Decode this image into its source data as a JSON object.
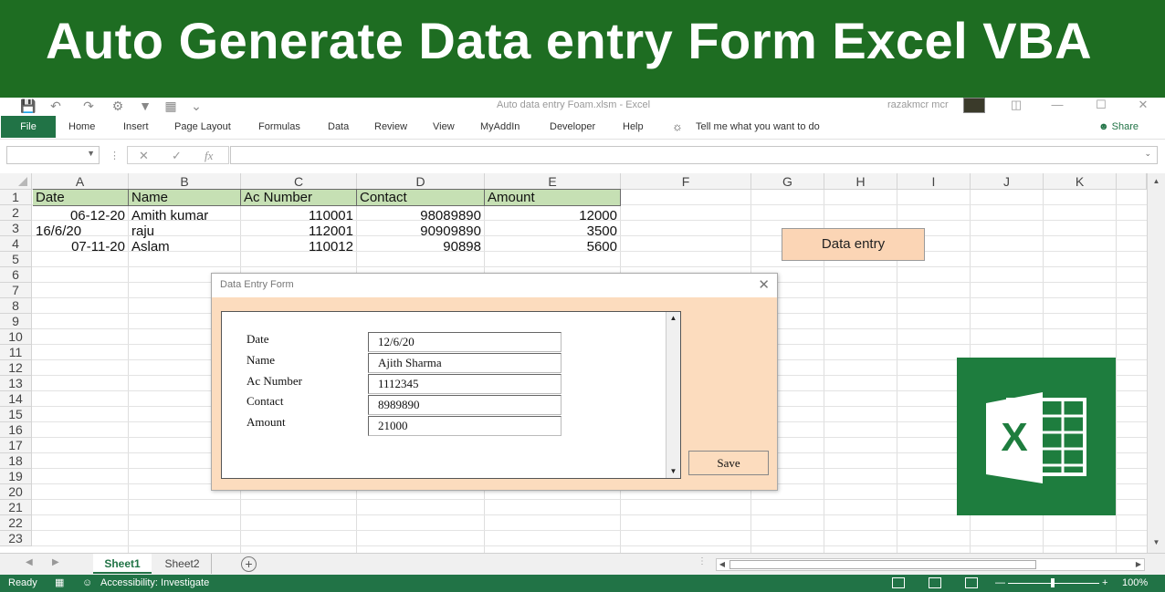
{
  "banner": {
    "title": "Auto Generate Data entry Form Excel VBA"
  },
  "titlebar": {
    "document_title": "Auto data entry Foam.xlsm  -  Excel",
    "user": "razakmcr mcr",
    "qa_icons": [
      "save-icon",
      "undo-icon",
      "redo-icon",
      "macro-icon",
      "filter-icon",
      "form-icon",
      "customize-icon"
    ]
  },
  "ribbon": {
    "file": "File",
    "tabs": [
      "Home",
      "Insert",
      "Page Layout",
      "Formulas",
      "Data",
      "Review",
      "View",
      "MyAddIn",
      "Developer",
      "Help"
    ],
    "tell_me": "Tell me what you want to do",
    "share": "Share"
  },
  "formula_bar": {
    "name_box": "",
    "cancel": "✕",
    "enter": "✓",
    "fx": "fx",
    "value": ""
  },
  "columns": [
    "A",
    "B",
    "C",
    "D",
    "E",
    "F",
    "G",
    "H",
    "I",
    "J",
    "K"
  ],
  "rows": [
    "1",
    "2",
    "3",
    "4",
    "5",
    "6",
    "7",
    "8",
    "9",
    "10",
    "11",
    "12",
    "13",
    "14",
    "15",
    "16",
    "17",
    "18",
    "19",
    "20",
    "21",
    "22",
    "23"
  ],
  "table": {
    "headers": [
      "Date",
      "Name",
      "Ac Number",
      "Contact",
      "Amount"
    ],
    "rows": [
      [
        "06-12-20",
        "Amith kumar",
        "110001",
        "98089890",
        "12000"
      ],
      [
        "16/6/20",
        "raju",
        "112001",
        "90909890",
        "3500"
      ],
      [
        "07-11-20",
        "Aslam",
        "110012",
        "90898",
        "5600"
      ]
    ]
  },
  "sheet_button": {
    "label": "Data entry"
  },
  "dialog": {
    "title": "Data Entry Form",
    "fields": [
      {
        "label": "Date",
        "value": "12/6/20"
      },
      {
        "label": "Name",
        "value": "Ajith Sharma"
      },
      {
        "label": "Ac Number",
        "value": "1112345"
      },
      {
        "label": "Contact",
        "value": "8989890"
      },
      {
        "label": "Amount",
        "value": "21000"
      }
    ],
    "save": "Save"
  },
  "sheets": {
    "tabs": [
      "Sheet1",
      "Sheet2"
    ],
    "active": "Sheet1"
  },
  "status": {
    "ready": "Ready",
    "accessibility": "Accessibility: Investigate",
    "zoom": "100%"
  },
  "colors": {
    "excel_green": "#217346",
    "banner_green": "#1e6d22",
    "header_fill": "#c6e0b4",
    "form_bg": "#fcdcbe"
  }
}
